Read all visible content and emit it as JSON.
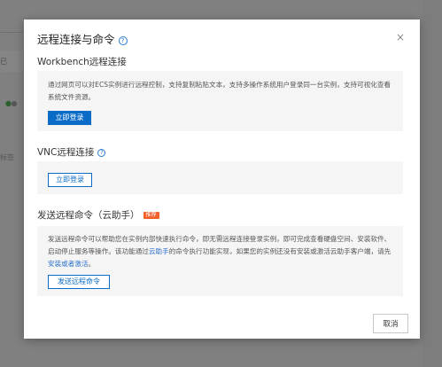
{
  "background": {
    "text_1": "已",
    "text_2": "标签"
  },
  "modal": {
    "title": "远程连接与命令",
    "help_glyph": "?",
    "close_glyph": "×",
    "workbench": {
      "title": "Workbench远程连接",
      "description": "通过网页可以对ECS实例进行远程控制，支持复制粘贴文本，支持多操作系统用户登录同一台实例，支持可视化查看系统文件资源。",
      "button": "立即登录"
    },
    "vnc": {
      "title": "VNC远程连接",
      "button": "立即登录"
    },
    "command": {
      "title": "发送远程命令（云助手）",
      "badge": "推荐",
      "description_part1": "发送远程命令可以帮助您在实例内部快速执行命令，即无需远程连接登录实例，即可完成查看硬盘空间、安装软件、启动停止服务等操作。该功能通过",
      "description_link1": "云助手",
      "description_part2": "的命令执行功能实现，如果您的实例还没有安装或激活云助手客户端，请先",
      "description_link2": "安装或者激活",
      "description_part3": "。",
      "button": "发送远程命令"
    },
    "cancel_button": "取消"
  },
  "colors": {
    "primary": "#0b6cc8",
    "badge": "#f4602a",
    "overlay": "#7f7f7f"
  }
}
